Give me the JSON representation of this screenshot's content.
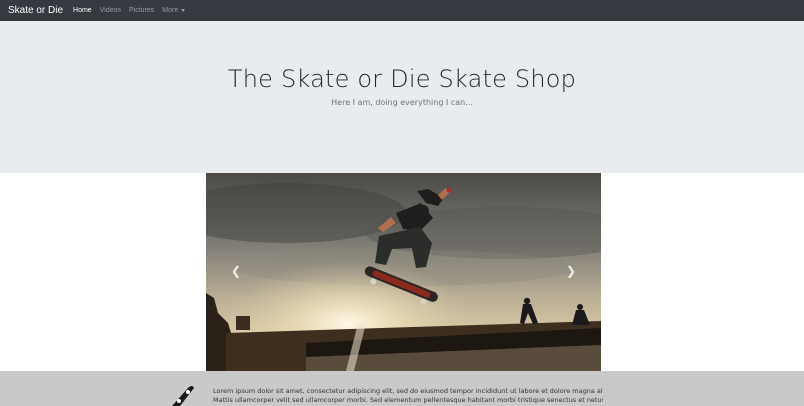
{
  "navbar": {
    "brand": "Skate or Die",
    "links": [
      "Home",
      "Videos",
      "Pictures",
      "More"
    ],
    "active_link": "Home",
    "colors": {
      "background": "#343a40",
      "active": "#ffffff",
      "inactive": "#9a9da0"
    }
  },
  "hero": {
    "title": "The Skate or Die Skate Shop",
    "subtitle": "Here I am, doing everything I can..."
  },
  "carousel": {
    "prev_icon": "chevron-left-icon",
    "next_icon": "chevron-right-icon"
  },
  "info": {
    "logo_icon": "skateboard-icon",
    "text_line1": "Lorem ipsum dolor sit amet, consectetur adipiscing elit, sed do eiusmod tempor incididunt ut labore et dolore magna aliqua.",
    "text_line2": "Mattis ullamcorper velit sed ullamcorper morbi. Sed elementum pellentesque habitant morbi tristique senectus et netus. Arcu non"
  }
}
